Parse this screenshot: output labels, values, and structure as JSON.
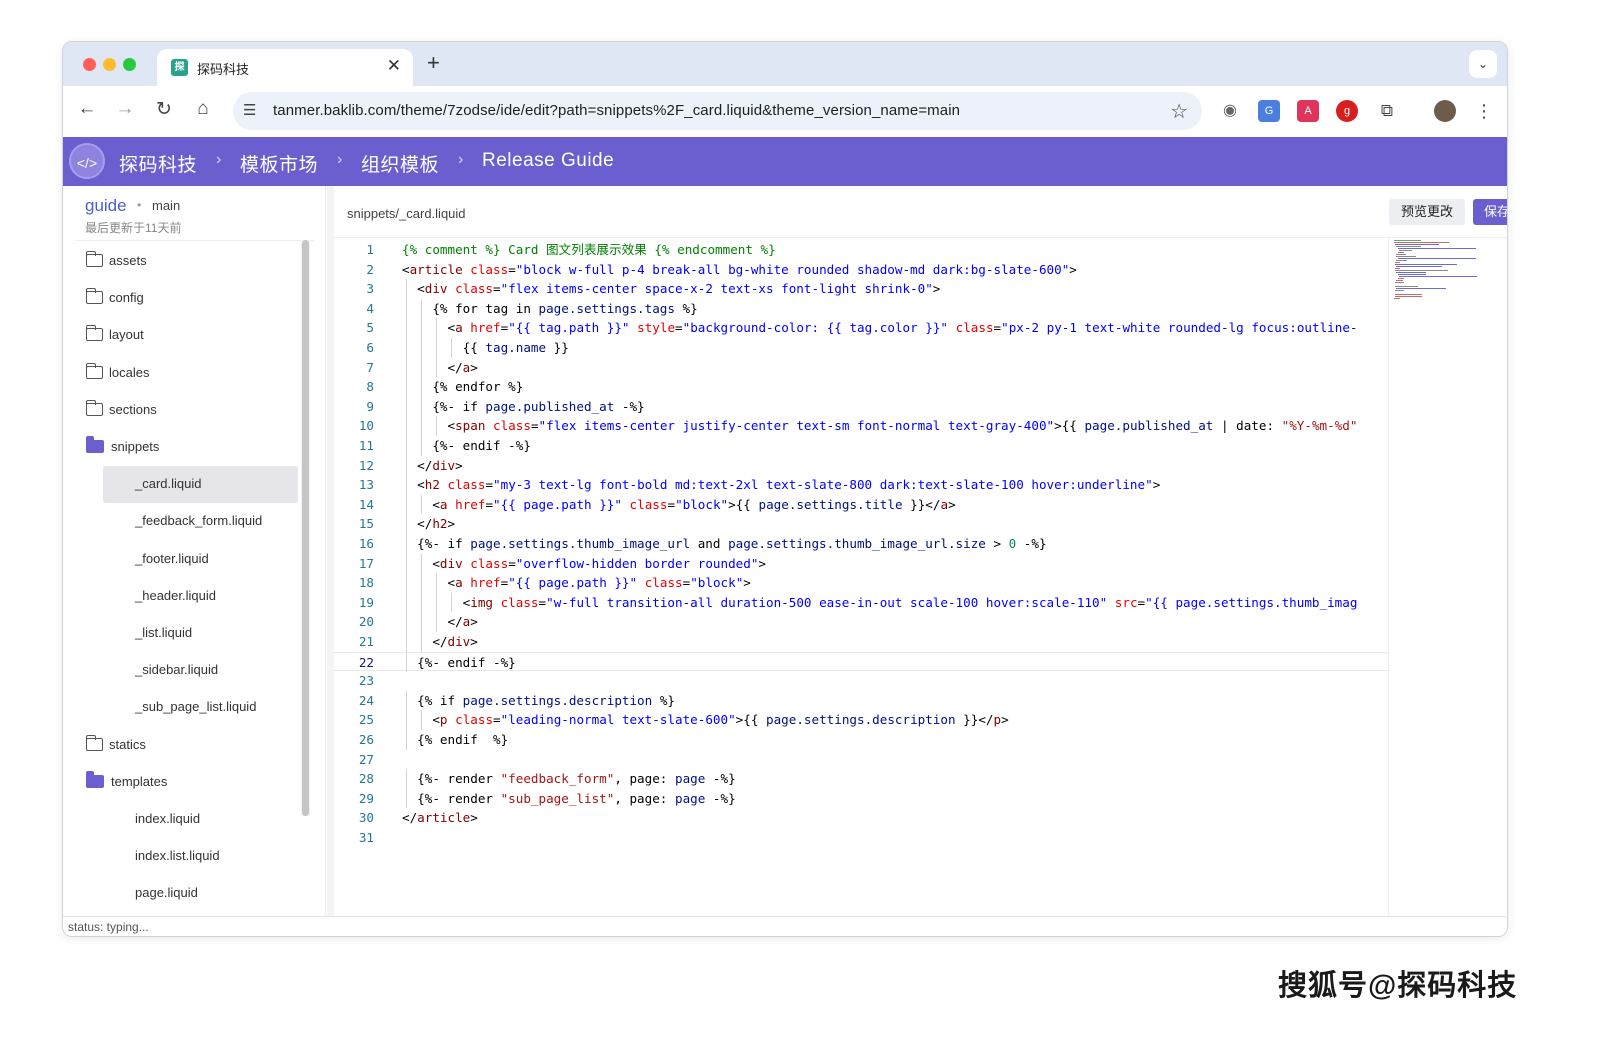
{
  "browser": {
    "tab_title": "探码科技",
    "tab_favicon": "探",
    "tab_close": "✕",
    "new_tab": "+",
    "url": "tanmer.baklib.com/theme/7zodse/ide/edit?path=snippets%2F_card.liquid&theme_version_name=main"
  },
  "header": {
    "logo": "</>",
    "breadcrumbs": [
      "探码科技",
      "模板市场",
      "组织模板",
      "Release Guide"
    ],
    "separator": "›"
  },
  "sidebar": {
    "repo": "guide",
    "dot": "•",
    "branch": "main",
    "updated": "最后更新于11天前",
    "items": [
      {
        "label": "assets",
        "type": "folder"
      },
      {
        "label": "config",
        "type": "folder"
      },
      {
        "label": "layout",
        "type": "folder"
      },
      {
        "label": "locales",
        "type": "folder"
      },
      {
        "label": "sections",
        "type": "folder"
      },
      {
        "label": "snippets",
        "type": "folder-open"
      },
      {
        "label": "_card.liquid",
        "type": "file",
        "active": true
      },
      {
        "label": "_feedback_form.liquid",
        "type": "file"
      },
      {
        "label": "_footer.liquid",
        "type": "file"
      },
      {
        "label": "_header.liquid",
        "type": "file"
      },
      {
        "label": "_list.liquid",
        "type": "file"
      },
      {
        "label": "_sidebar.liquid",
        "type": "file"
      },
      {
        "label": "_sub_page_list.liquid",
        "type": "file"
      },
      {
        "label": "statics",
        "type": "folder"
      },
      {
        "label": "templates",
        "type": "folder-open"
      },
      {
        "label": "index.liquid",
        "type": "file"
      },
      {
        "label": "index.list.liquid",
        "type": "file"
      },
      {
        "label": "page.liquid",
        "type": "file"
      }
    ]
  },
  "editor": {
    "file_path": "snippets/_card.liquid",
    "preview_button": "预览更改",
    "save_button": "保存",
    "current_line": 22,
    "lines": [
      [
        [
          "c",
          "{% comment %} Card 图文列表展示效果 {% endcomment %}"
        ]
      ],
      [
        [
          "g",
          "<"
        ],
        [
          "t",
          "article"
        ],
        [
          "g",
          " "
        ],
        [
          "a",
          "class"
        ],
        [
          "g",
          "="
        ],
        [
          "s",
          "\"block w-full p-4 break-all bg-white rounded shadow-md dark:bg-slate-600\""
        ],
        [
          "g",
          ">"
        ]
      ],
      [
        [
          "g",
          "  <"
        ],
        [
          "t",
          "div"
        ],
        [
          "g",
          " "
        ],
        [
          "a",
          "class"
        ],
        [
          "g",
          "="
        ],
        [
          "s",
          "\"flex items-center space-x-2 text-xs font-light shrink-0\""
        ],
        [
          "g",
          ">"
        ]
      ],
      [
        [
          "g",
          "    {% for tag in "
        ],
        [
          "v",
          "page.settings.tags"
        ],
        [
          "g",
          " %}"
        ]
      ],
      [
        [
          "g",
          "      <"
        ],
        [
          "t",
          "a"
        ],
        [
          "g",
          " "
        ],
        [
          "a",
          "href"
        ],
        [
          "g",
          "="
        ],
        [
          "s",
          "\"{{ tag.path }}\""
        ],
        [
          "g",
          " "
        ],
        [
          "a",
          "style"
        ],
        [
          "g",
          "="
        ],
        [
          "s",
          "\"background-color: {{ tag.color }}\""
        ],
        [
          "g",
          " "
        ],
        [
          "a",
          "class"
        ],
        [
          "g",
          "="
        ],
        [
          "s",
          "\"px-2 py-1 text-white rounded-lg focus:outline-"
        ]
      ],
      [
        [
          "g",
          "        {{ "
        ],
        [
          "v",
          "tag.name"
        ],
        [
          "g",
          " }}"
        ]
      ],
      [
        [
          "g",
          "      </"
        ],
        [
          "t",
          "a"
        ],
        [
          "g",
          ">"
        ]
      ],
      [
        [
          "g",
          "    {% endfor %}"
        ]
      ],
      [
        [
          "g",
          "    {%- if "
        ],
        [
          "v",
          "page.published_at"
        ],
        [
          "g",
          " -%}"
        ]
      ],
      [
        [
          "g",
          "      <"
        ],
        [
          "t",
          "span"
        ],
        [
          "g",
          " "
        ],
        [
          "a",
          "class"
        ],
        [
          "g",
          "="
        ],
        [
          "s",
          "\"flex items-center justify-center text-sm font-normal text-gray-400\""
        ],
        [
          "g",
          ">{{ "
        ],
        [
          "v",
          "page.published_at"
        ],
        [
          "g",
          " | date: "
        ],
        [
          "r",
          "\"%Y-%m-%d\""
        ]
      ],
      [
        [
          "g",
          "    {%- endif -%}"
        ]
      ],
      [
        [
          "g",
          "  </"
        ],
        [
          "t",
          "div"
        ],
        [
          "g",
          ">"
        ]
      ],
      [
        [
          "g",
          "  <"
        ],
        [
          "t",
          "h2"
        ],
        [
          "g",
          " "
        ],
        [
          "a",
          "class"
        ],
        [
          "g",
          "="
        ],
        [
          "s",
          "\"my-3 text-lg font-bold md:text-2xl text-slate-800 dark:text-slate-100 hover:underline\""
        ],
        [
          "g",
          ">"
        ]
      ],
      [
        [
          "g",
          "    <"
        ],
        [
          "t",
          "a"
        ],
        [
          "g",
          " "
        ],
        [
          "a",
          "href"
        ],
        [
          "g",
          "="
        ],
        [
          "s",
          "\"{{ page.path }}\""
        ],
        [
          "g",
          " "
        ],
        [
          "a",
          "class"
        ],
        [
          "g",
          "="
        ],
        [
          "s",
          "\"block\""
        ],
        [
          "g",
          ">{{ "
        ],
        [
          "v",
          "page.settings.title"
        ],
        [
          "g",
          " }}</"
        ],
        [
          "t",
          "a"
        ],
        [
          "g",
          ">"
        ]
      ],
      [
        [
          "g",
          "  </"
        ],
        [
          "t",
          "h2"
        ],
        [
          "g",
          ">"
        ]
      ],
      [
        [
          "g",
          "  {%- if "
        ],
        [
          "v",
          "page.settings.thumb_image_url"
        ],
        [
          "g",
          " and "
        ],
        [
          "v",
          "page.settings.thumb_image_url.size"
        ],
        [
          "g",
          " > "
        ],
        [
          "n",
          "0"
        ],
        [
          "g",
          " -%}"
        ]
      ],
      [
        [
          "g",
          "    <"
        ],
        [
          "t",
          "div"
        ],
        [
          "g",
          " "
        ],
        [
          "a",
          "class"
        ],
        [
          "g",
          "="
        ],
        [
          "s",
          "\"overflow-hidden border rounded\""
        ],
        [
          "g",
          ">"
        ]
      ],
      [
        [
          "g",
          "      <"
        ],
        [
          "t",
          "a"
        ],
        [
          "g",
          " "
        ],
        [
          "a",
          "href"
        ],
        [
          "g",
          "="
        ],
        [
          "s",
          "\"{{ page.path }}\""
        ],
        [
          "g",
          " "
        ],
        [
          "a",
          "class"
        ],
        [
          "g",
          "="
        ],
        [
          "s",
          "\"block\""
        ],
        [
          "g",
          ">"
        ]
      ],
      [
        [
          "g",
          "        <"
        ],
        [
          "t",
          "img"
        ],
        [
          "g",
          " "
        ],
        [
          "a",
          "class"
        ],
        [
          "g",
          "="
        ],
        [
          "s",
          "\"w-full transition-all duration-500 ease-in-out scale-100 hover:scale-110\""
        ],
        [
          "g",
          " "
        ],
        [
          "a",
          "src"
        ],
        [
          "g",
          "="
        ],
        [
          "s",
          "\"{{ page.settings.thumb_imag"
        ]
      ],
      [
        [
          "g",
          "      </"
        ],
        [
          "t",
          "a"
        ],
        [
          "g",
          ">"
        ]
      ],
      [
        [
          "g",
          "    </"
        ],
        [
          "t",
          "div"
        ],
        [
          "g",
          ">"
        ]
      ],
      [
        [
          "g",
          "  {%- endif -%}"
        ]
      ],
      [
        [
          "g",
          ""
        ]
      ],
      [
        [
          "g",
          "  {% if "
        ],
        [
          "v",
          "page.settings.description"
        ],
        [
          "g",
          " %}"
        ]
      ],
      [
        [
          "g",
          "    <"
        ],
        [
          "t",
          "p"
        ],
        [
          "g",
          " "
        ],
        [
          "a",
          "class"
        ],
        [
          "g",
          "="
        ],
        [
          "s",
          "\"leading-normal text-slate-600\""
        ],
        [
          "g",
          ">{{ "
        ],
        [
          "v",
          "page.settings.description"
        ],
        [
          "g",
          " }}</"
        ],
        [
          "t",
          "p"
        ],
        [
          "g",
          ">"
        ]
      ],
      [
        [
          "g",
          "  {% endif  %}"
        ]
      ],
      [
        [
          "g",
          ""
        ]
      ],
      [
        [
          "g",
          "  {%- render "
        ],
        [
          "r",
          "\"feedback_form\""
        ],
        [
          "g",
          ", page: "
        ],
        [
          "v",
          "page"
        ],
        [
          "g",
          " -%}"
        ]
      ],
      [
        [
          "g",
          "  {%- render "
        ],
        [
          "r",
          "\"sub_page_list\""
        ],
        [
          "g",
          ", page: "
        ],
        [
          "v",
          "page"
        ],
        [
          "g",
          " -%}"
        ]
      ],
      [
        [
          "g",
          "</"
        ],
        [
          "t",
          "article"
        ],
        [
          "g",
          ">"
        ]
      ],
      [
        [
          "g",
          ""
        ]
      ]
    ]
  },
  "status": {
    "text": "status: typing..."
  },
  "watermark": "搜狐号@探码科技",
  "colors": {
    "accent": "#6b5fd0",
    "link": "#4a5ed0"
  }
}
